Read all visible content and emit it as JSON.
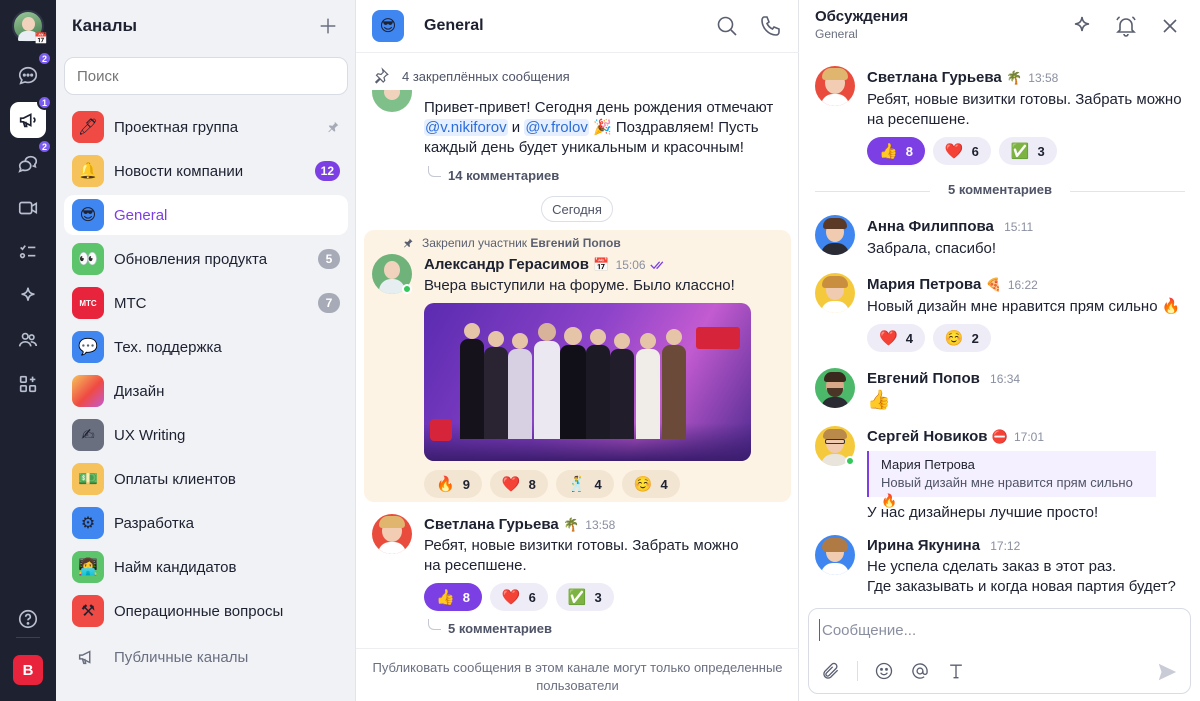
{
  "rail": {
    "calendar_icon_glyph": "📅",
    "badges": [
      "2",
      "1",
      "2"
    ],
    "user_initial": "B"
  },
  "channels": {
    "title": "Каналы",
    "search_placeholder": "Поиск",
    "items": [
      {
        "name": "Проектная группа",
        "icon": "🖊",
        "color": "#ef4a43",
        "count": "",
        "pinned": true
      },
      {
        "name": "Новости компании",
        "icon": "🔔",
        "color": "#f5c25c",
        "count": "12",
        "count_style": "unread"
      },
      {
        "name": "General",
        "icon": "😎",
        "color": "#3f86f0",
        "count": "",
        "active": true
      },
      {
        "name": "Обновления продукта",
        "icon": "👀",
        "color": "#5cc46b",
        "count": "5",
        "count_style": "muted"
      },
      {
        "name": "МТС",
        "icon": "МТС",
        "color": "#e8233c",
        "count": "7",
        "count_style": "muted"
      },
      {
        "name": "Тех. поддержка",
        "icon": "💬",
        "color": "#3f86f0",
        "count": ""
      },
      {
        "name": "Дизайн",
        "icon": "",
        "color": "#f29a5a",
        "count": ""
      },
      {
        "name": "UX Writing",
        "icon": "✍",
        "color": "#6a6f80",
        "count": ""
      },
      {
        "name": "Оплаты клиентов",
        "icon": "💵",
        "color": "#f5c25c",
        "count": ""
      },
      {
        "name": "Разработка",
        "icon": "⚙",
        "color": "#3f86f0",
        "count": ""
      },
      {
        "name": "Найм кандидатов",
        "icon": "👩‍💻",
        "color": "#5cc46b",
        "count": ""
      },
      {
        "name": "Операционные вопросы",
        "icon": "⚒",
        "color": "#ef4a43",
        "count": ""
      }
    ],
    "public_label": "Публичные каналы"
  },
  "chat": {
    "channel_icon": "😎",
    "channel_name": "General",
    "pinned_label": "4 закреплённых сообщения",
    "msg0": {
      "text_a": "Привет-привет! Сегодня день рождения отмечают ",
      "mention1": "@v.nikiforov",
      "text_b": " и ",
      "mention2": "@v.frolov",
      "text_c": " 🎉 Поздравляем! Пусть каждый день будет уникальным и красочным!",
      "replies": "14 комментариев"
    },
    "date_chip": "Сегодня",
    "pinned_note_prefix": "Закрепил участник ",
    "pinned_note_user": "Евгений Попов",
    "msg1": {
      "author": "Александр Герасимов",
      "badge": "📅",
      "time": "15:06",
      "text": "Вчера выступили на форуме. Было классно!",
      "reactions": [
        {
          "emoji": "🔥",
          "count": "9"
        },
        {
          "emoji": "❤️",
          "count": "8"
        },
        {
          "emoji": "🕺",
          "count": "4"
        },
        {
          "emoji": "☺️",
          "count": "4"
        }
      ]
    },
    "msg2": {
      "author": "Светлана Гурьева",
      "badge": "🌴",
      "time": "13:58",
      "text": "Ребят, новые визитки готовы. Забрать можно на ресепшене.",
      "reactions": [
        {
          "emoji": "👍",
          "count": "8",
          "mine": true
        },
        {
          "emoji": "❤️",
          "count": "6"
        },
        {
          "emoji": "✅",
          "count": "3"
        }
      ],
      "replies": "5 комментариев"
    },
    "footer": "Публиковать сообщения в этом канале могут только определенные пользователи"
  },
  "thread": {
    "title": "Обсуждения",
    "subtitle": "General",
    "root": {
      "author": "Светлана Гурьева",
      "badge": "🌴",
      "time": "13:58",
      "text": "Ребят, новые визитки готовы. Забрать можно на ресепшене.",
      "reactions": [
        {
          "emoji": "👍",
          "count": "8",
          "mine": true
        },
        {
          "emoji": "❤️",
          "count": "6"
        },
        {
          "emoji": "✅",
          "count": "3"
        }
      ]
    },
    "count_label": "5 комментариев",
    "comments": [
      {
        "author": "Анна Филиппова",
        "badge": "",
        "time": "15:11",
        "text": "Забрала, спасибо!"
      },
      {
        "author": "Мария Петрова",
        "badge": "🍕",
        "time": "16:22",
        "text": "Новый дизайн мне нравится прям сильно 🔥",
        "reactions": [
          {
            "emoji": "❤️",
            "count": "4"
          },
          {
            "emoji": "☺️",
            "count": "2"
          }
        ]
      },
      {
        "author": "Евгений Попов",
        "badge": "",
        "time": "16:34",
        "text": "👍"
      },
      {
        "author": "Сергей Новиков",
        "badge": "⛔",
        "time": "17:01",
        "quote_author": "Мария Петрова",
        "quote_text": "Новый дизайн мне нравится прям сильно 🔥",
        "text": "У нас дизайнеры лучшие просто!"
      },
      {
        "author": "Ирина Якунина",
        "badge": "",
        "time": "17:12",
        "text": "Не успела сделать заказ в этот раз.",
        "text2": "Где заказывать и когда новая партия будет?"
      }
    ],
    "composer_placeholder": "Сообщение..."
  },
  "colors": {
    "accent": "#7b3fe4",
    "rail": "#1e2230",
    "pinned_bg": "#fdf3e4"
  }
}
